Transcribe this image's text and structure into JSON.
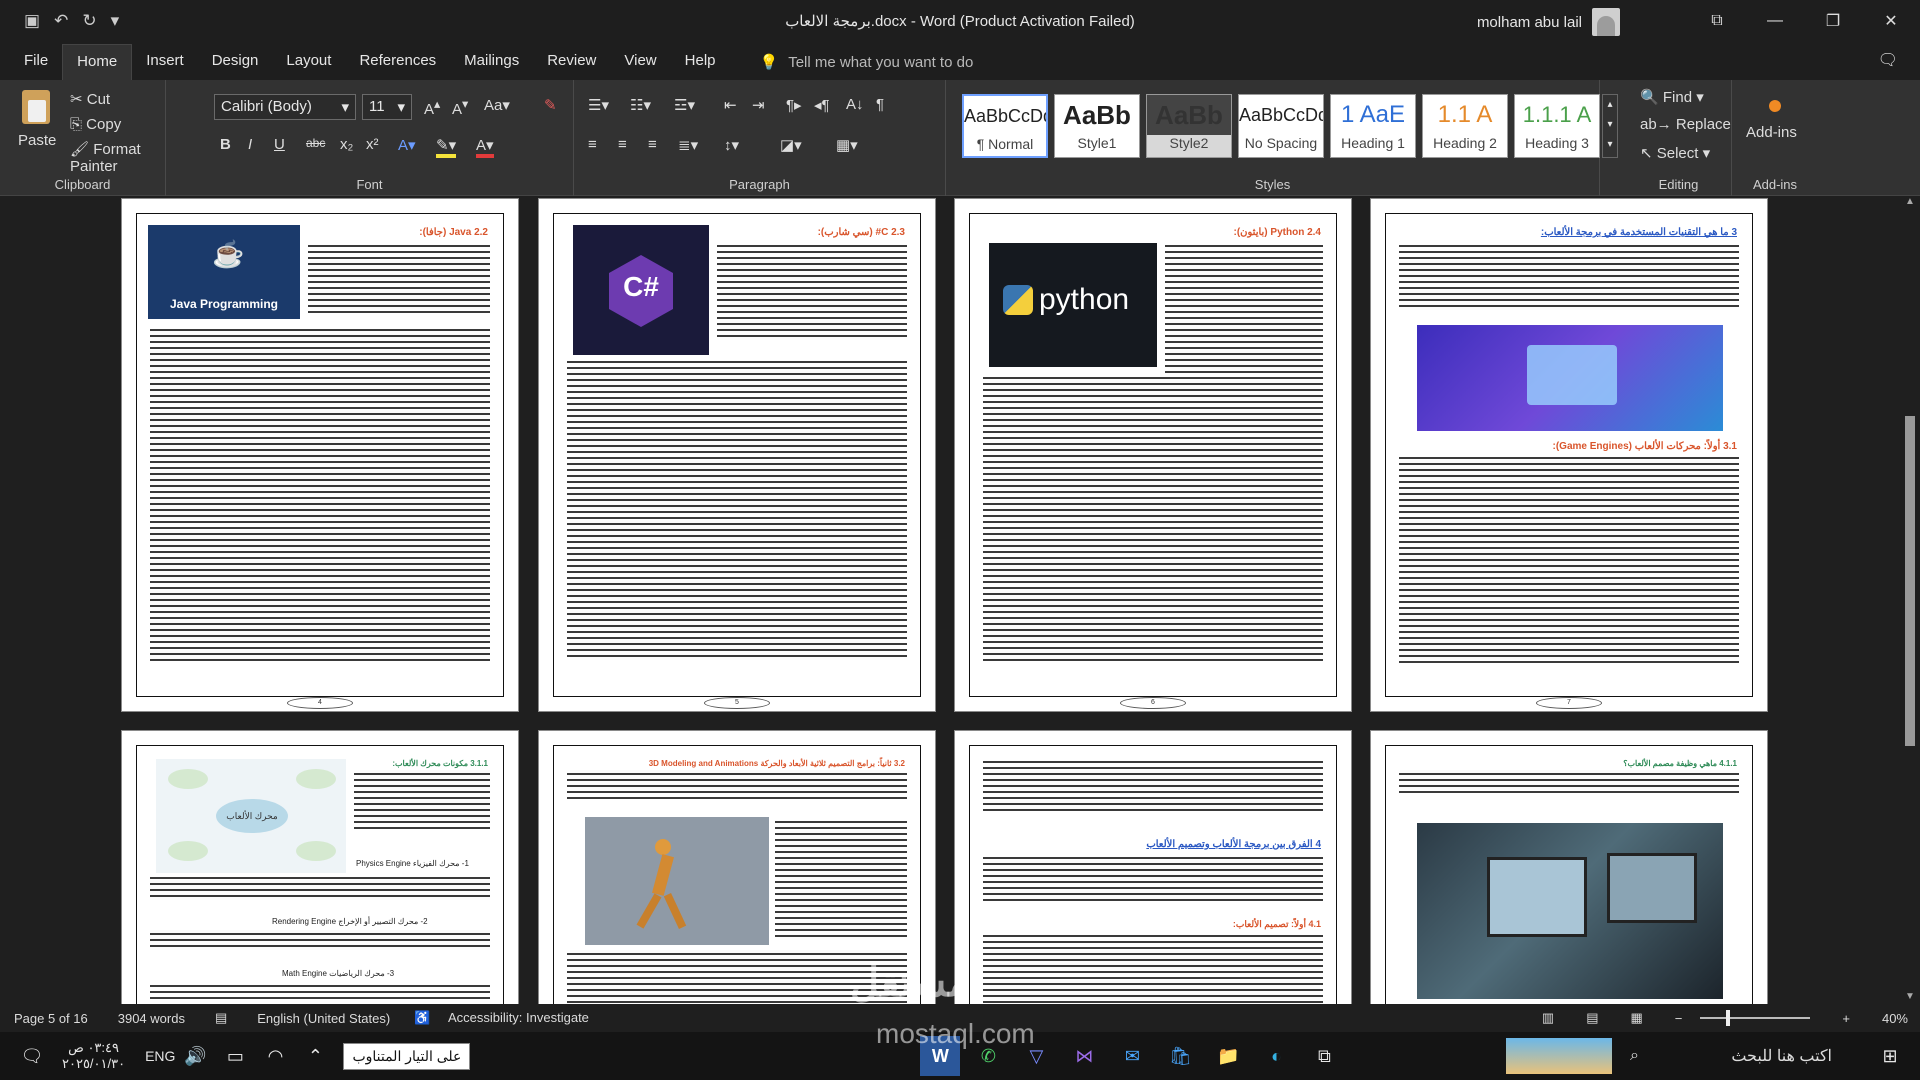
{
  "titlebar": {
    "title": "برمجة الالعاب.docx  -  Word (Product Activation Failed)",
    "user": "molham abu lail"
  },
  "menu": {
    "tabs": [
      "File",
      "Home",
      "Insert",
      "Design",
      "Layout",
      "References",
      "Mailings",
      "Review",
      "View",
      "Help"
    ],
    "tell_me": "Tell me what you want to do"
  },
  "clipboard": {
    "paste": "Paste",
    "cut": "Cut",
    "copy": "Copy",
    "format_painter": "Format Painter",
    "label": "Clipboard"
  },
  "font": {
    "family": "Calibri (Body)",
    "size": "11",
    "label": "Font"
  },
  "paragraph": {
    "label": "Paragraph"
  },
  "styles": {
    "label": "Styles",
    "items": [
      {
        "preview": "AaBbCcDd",
        "name": "¶ Normal"
      },
      {
        "preview": "AaBb",
        "name": "Style1"
      },
      {
        "preview": "AaBb",
        "name": "Style2"
      },
      {
        "preview": "AaBbCcDd",
        "name": "No Spacing"
      },
      {
        "preview": "1 AaE",
        "name": "Heading 1"
      },
      {
        "preview": "1.1 A",
        "name": "Heading 2"
      },
      {
        "preview": "1.1.1 A",
        "name": "Heading 3"
      }
    ]
  },
  "editing": {
    "find": "Find",
    "replace": "Replace",
    "select": "Select",
    "label": "Editing"
  },
  "addins": {
    "button": "Add-ins",
    "label": "Add-ins"
  },
  "pages": {
    "p1": {
      "heading": "2.2 Java (جافا):",
      "image_text": "Java Programming",
      "number": "4"
    },
    "p2": {
      "heading": "2.3 C# (سي شارب):",
      "image_text": "C#",
      "number": "5"
    },
    "p3": {
      "heading": "2.4 Python (بايثون):",
      "image_text": "python",
      "number": "6"
    },
    "p4": {
      "heading": "3   ما هي التقنيات المستخدمة في برمجة الألعاب:",
      "sub": "3.1  أولاً: محركات الألعاب (Game Engines):",
      "number": "7"
    },
    "p5": {
      "heading": "3.1.1 مكونات محرك الألعاب:",
      "image_text": "محرك الألعاب",
      "physics": "1- محرك الفيزياء Physics Engine",
      "render": "2- محرك التصيير أو الإخراج Rendering Engine",
      "math": "3- محرك الرياضيات Math Engine"
    },
    "p6": {
      "heading": "3.2 ثانياً: برامج التصميم ثلاثية الأبعاد والحركة 3D Modeling and Animations"
    },
    "p7": {
      "heading": "4   الفرق بين برمجة الألعاب وتصميم الألعاب",
      "sub": "4.1 أولاً: تصميم الألعاب:"
    },
    "p8": {
      "heading": "4.1.1 ماهي وظيفة مصمم الألعاب؟"
    }
  },
  "status": {
    "page": "Page 5 of 16",
    "words": "3904 words",
    "language": "English (United States)",
    "accessibility": "Accessibility: Investigate",
    "zoom": "40%"
  },
  "taskbar": {
    "search": "اكتب هنا للبحث",
    "news": "على التيار المتناوب",
    "time": "٠٣:٤٩ ص",
    "date": "٢٠٢٥/٠١/٣٠",
    "lang": "ENG"
  },
  "watermark": {
    "brand": "مستقل",
    "site": "mostaql.com"
  }
}
